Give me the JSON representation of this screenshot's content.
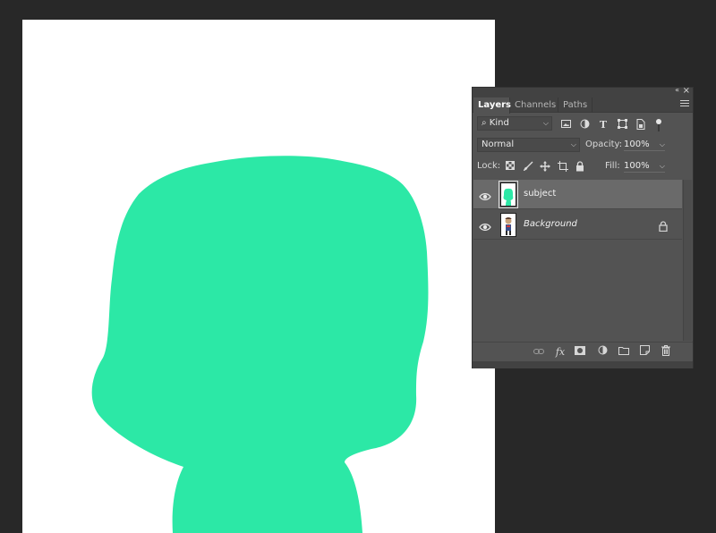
{
  "colors": {
    "canvas_bg": "#ffffff",
    "subject_fill": "#2ce8a6",
    "workspace_bg": "#282828",
    "panel_bg": "#535353",
    "selected_row": "#6a6a6a"
  },
  "panel": {
    "collapse_glyph": "«",
    "close_glyph": "×",
    "tabs": [
      {
        "label": "Layers",
        "active": true
      },
      {
        "label": "Channels",
        "active": false
      },
      {
        "label": "Paths",
        "active": false
      }
    ],
    "filter": {
      "kind_label": "Kind",
      "search_glyph": "⌕",
      "icons": [
        "image-icon",
        "adjustment-icon",
        "type-icon",
        "shape-icon",
        "smart-object-icon"
      ]
    },
    "blend": {
      "mode": "Normal",
      "opacity_label": "Opacity:",
      "opacity_value": "100%"
    },
    "lock": {
      "label": "Lock:",
      "fill_label": "Fill:",
      "fill_value": "100%"
    },
    "layers": [
      {
        "name": "subject",
        "selected": true,
        "italic": false,
        "locked": false,
        "visible": true
      },
      {
        "name": "Background",
        "selected": false,
        "italic": true,
        "locked": true,
        "visible": true
      }
    ],
    "footer_icons": [
      "link-icon",
      "fx-icon",
      "mask-icon",
      "adjustment-layer-icon",
      "folder-icon",
      "new-layer-icon",
      "trash-icon"
    ],
    "footer_fx_label": "fx"
  }
}
